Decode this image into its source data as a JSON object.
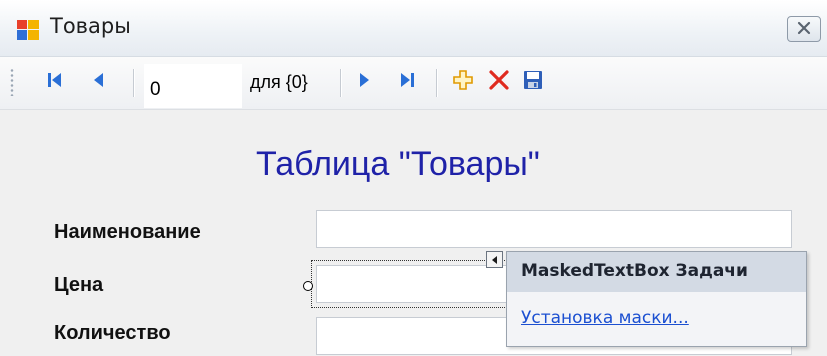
{
  "window": {
    "title": "Товары",
    "icon": "form-icon",
    "close_icon": "close-icon"
  },
  "navigator": {
    "position_value": "0",
    "count_label": "для {0}",
    "buttons": {
      "move_first": "move-first-icon",
      "move_previous": "move-previous-icon",
      "move_next": "move-next-icon",
      "move_last": "move-last-icon",
      "add_new": "add-new-icon",
      "delete": "delete-icon",
      "save": "save-icon"
    }
  },
  "form": {
    "heading": "Таблица \"Товары\"",
    "fields": [
      {
        "label": "Наименование",
        "value": ""
      },
      {
        "label": "Цена",
        "value": ""
      },
      {
        "label": "Количество",
        "value": ""
      }
    ]
  },
  "smart_tasks": {
    "title": "MaskedTextBox Задачи",
    "link": "Установка маски..."
  },
  "colors": {
    "heading": "#1f22a8",
    "link": "#1b4fd1",
    "tasks_header": "#d3dae4",
    "delete_icon": "#e02b1f",
    "add_icon": "#f0a800",
    "nav_icon": "#2a6fd6"
  }
}
